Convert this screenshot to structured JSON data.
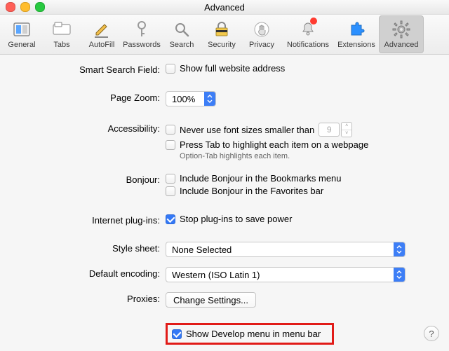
{
  "title": "Advanced",
  "toolbar": {
    "items": [
      {
        "key": "general",
        "label": "General"
      },
      {
        "key": "tabs",
        "label": "Tabs"
      },
      {
        "key": "autofill",
        "label": "AutoFill"
      },
      {
        "key": "passwords",
        "label": "Passwords"
      },
      {
        "key": "search",
        "label": "Search"
      },
      {
        "key": "security",
        "label": "Security"
      },
      {
        "key": "privacy",
        "label": "Privacy"
      },
      {
        "key": "notifications",
        "label": "Notifications"
      },
      {
        "key": "extensions",
        "label": "Extensions"
      },
      {
        "key": "advanced",
        "label": "Advanced"
      }
    ]
  },
  "labels": {
    "smart_search": "Smart Search Field:",
    "page_zoom": "Page Zoom:",
    "accessibility": "Accessibility:",
    "bonjour": "Bonjour:",
    "plugins": "Internet plug-ins:",
    "stylesheet": "Style sheet:",
    "default_encoding": "Default encoding:",
    "proxies": "Proxies:"
  },
  "fields": {
    "show_full_addr": "Show full website address",
    "zoom_value": "100%",
    "never_font_sizes": "Never use font sizes smaller than",
    "min_font_value": "9",
    "press_tab": "Press Tab to highlight each item on a webpage",
    "option_hint": "Option-Tab highlights each item.",
    "bonjour_bookmarks": "Include Bonjour in the Bookmarks menu",
    "bonjour_favorites": "Include Bonjour in the Favorites bar",
    "stop_plugins": "Stop plug-ins to save power",
    "stylesheet_value": "None Selected",
    "encoding_value": "Western (ISO Latin 1)",
    "proxies_button": "Change Settings...",
    "show_develop": "Show Develop menu in menu bar"
  },
  "help": "?"
}
